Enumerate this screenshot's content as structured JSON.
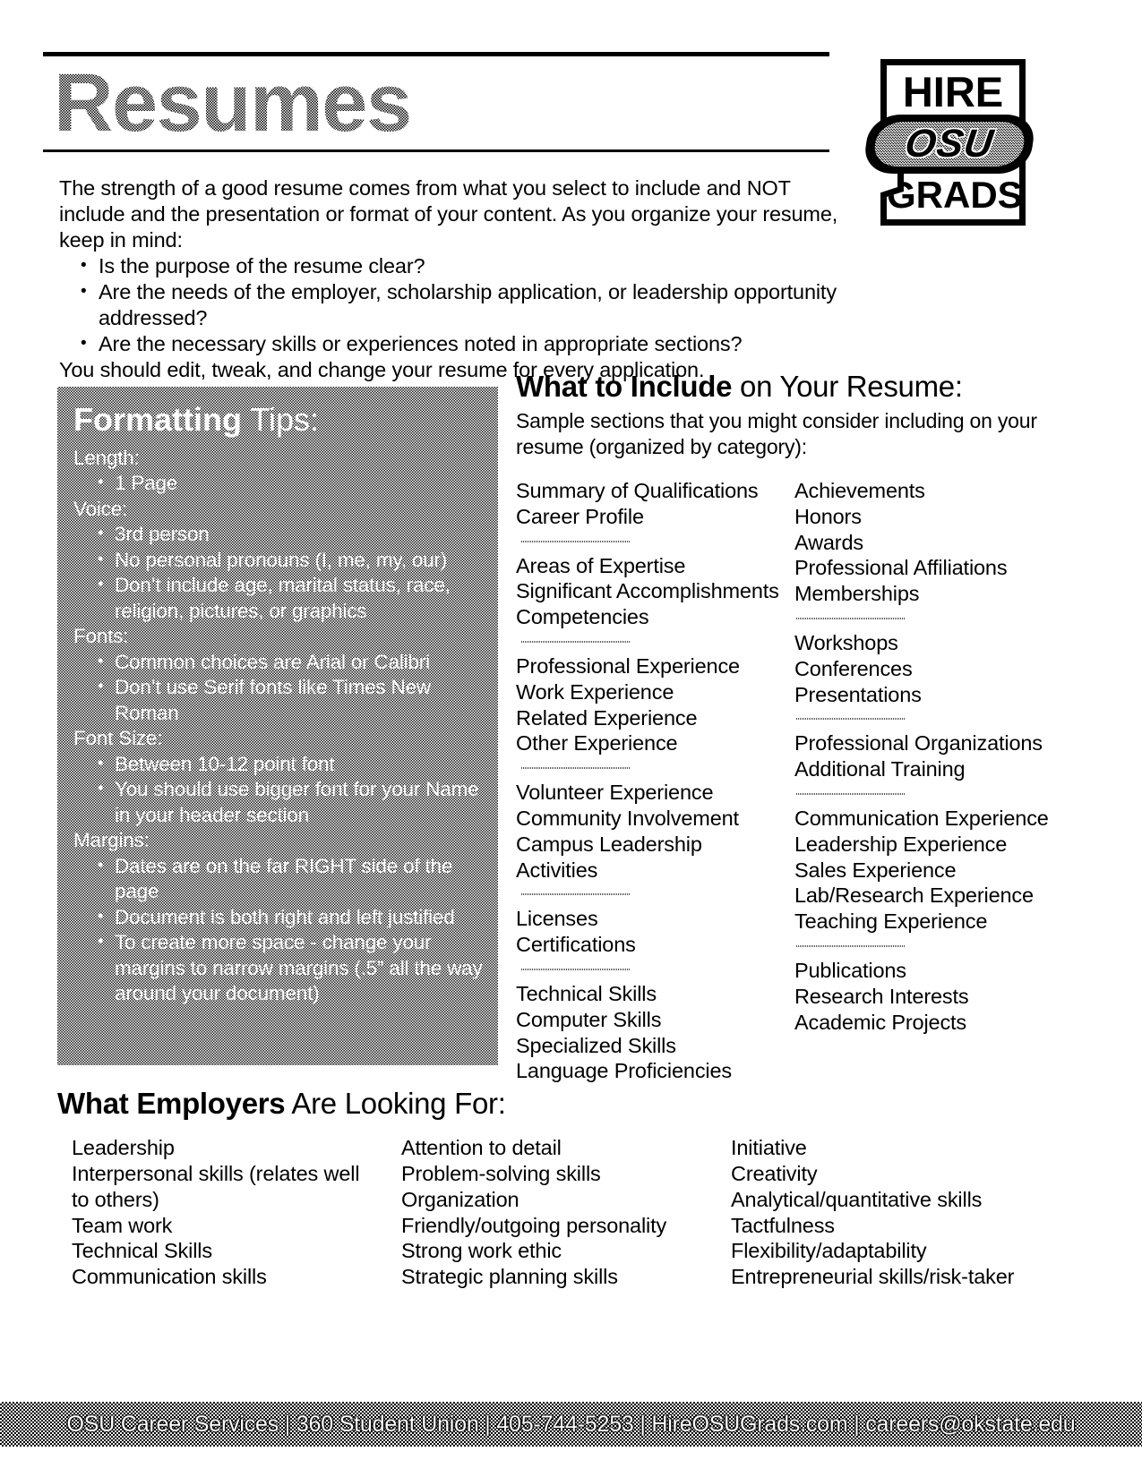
{
  "header": {
    "title": "Resumes",
    "logo": {
      "top_text": "HIRE",
      "middle_text": "OSU",
      "bottom_text": "GRADS"
    }
  },
  "intro": {
    "paragraph": "The strength of a good resume comes from what you select to include and NOT include and the presentation or format of your content. As you organize your resume, keep in mind:",
    "bullets": [
      "Is the purpose of the resume clear?",
      "Are the needs of the employer, scholarship application, or leadership opportunity addressed?",
      "Are the necessary skills or experiences noted in appropriate sections?"
    ],
    "closing": "You should edit, tweak, and change your resume for every application."
  },
  "formatting_tips": {
    "title_bold": "Formatting",
    "title_regular": " Tips:",
    "groups": [
      {
        "heading": "Length:",
        "items": [
          "1 Page"
        ]
      },
      {
        "heading": "Voice:",
        "items": [
          "3rd person",
          "No personal pronouns (I, me, my, our)",
          "Don’t include age, marital status, race, religion, pictures, or graphics"
        ]
      },
      {
        "heading": "Fonts:",
        "items": [
          "Common choices are Arial or Calibri",
          "Don’t use Serif fonts like Times New Roman"
        ]
      },
      {
        "heading": "Font Size:",
        "items": [
          "Between 10-12 point font",
          "You should use bigger font for your Name in your header section"
        ]
      },
      {
        "heading": "Margins:",
        "items": [
          "Dates are on the far RIGHT side of the page",
          "Document is both right and left justified",
          "To create more space - change your margins to narrow margins (.5” all the way around your document)"
        ]
      }
    ]
  },
  "what_to_include": {
    "heading_bold": "What to Include",
    "heading_regular": " on Your Resume:",
    "subtitle": "Sample sections that you might consider including on your resume (organized by category):",
    "left_groups": [
      [
        "Summary of Qualifications",
        "Career Profile"
      ],
      [
        "Areas of Expertise",
        "Significant Accomplishments",
        "Competencies"
      ],
      [
        "Professional Experience",
        "Work Experience",
        "Related Experience",
        "Other Experience"
      ],
      [
        "Volunteer Experience",
        "Community Involvement",
        "Campus Leadership",
        "Activities"
      ],
      [
        "Licenses",
        "Certifications"
      ],
      [
        "Technical Skills",
        "Computer Skills",
        "Specialized Skills",
        "Language Proficiencies"
      ]
    ],
    "right_groups": [
      [
        "Achievements",
        "Honors",
        "Awards",
        "Professional Affiliations",
        "Memberships"
      ],
      [
        "Workshops",
        "Conferences",
        "Presentations"
      ],
      [
        "Professional Organizations",
        "Additional Training"
      ],
      [
        "Communication Experience",
        "Leadership Experience",
        "Sales Experience",
        "Lab/Research Experience",
        "Teaching Experience"
      ],
      [
        "Publications",
        "Research Interests",
        "Academic Projects"
      ]
    ]
  },
  "what_employers": {
    "heading_bold": "What Employers",
    "heading_regular": " Are Looking For:",
    "columns": [
      [
        "Leadership",
        "Interpersonal skills (relates well",
        "to others)",
        "Team work",
        "Technical Skills",
        "Communication skills"
      ],
      [
        "Attention to detail",
        "Problem-solving skills",
        "Organization",
        "Friendly/outgoing personality",
        "Strong work ethic",
        "Strategic planning skills"
      ],
      [
        "Initiative",
        "Creativity",
        "Analytical/quantitative skills",
        "Tactfulness",
        "Flexibility/adaptability",
        "Entrepreneurial skills/risk-taker"
      ]
    ]
  },
  "footer": {
    "text": "OSU Career Services  |  360 Student Union  |  405-744-5253  |  HireOSUGrads.com  |  careers@okstate.edu"
  },
  "colors": {
    "ink": "#000000",
    "panel_gray": "#8e8e8e",
    "paper": "#ffffff"
  }
}
